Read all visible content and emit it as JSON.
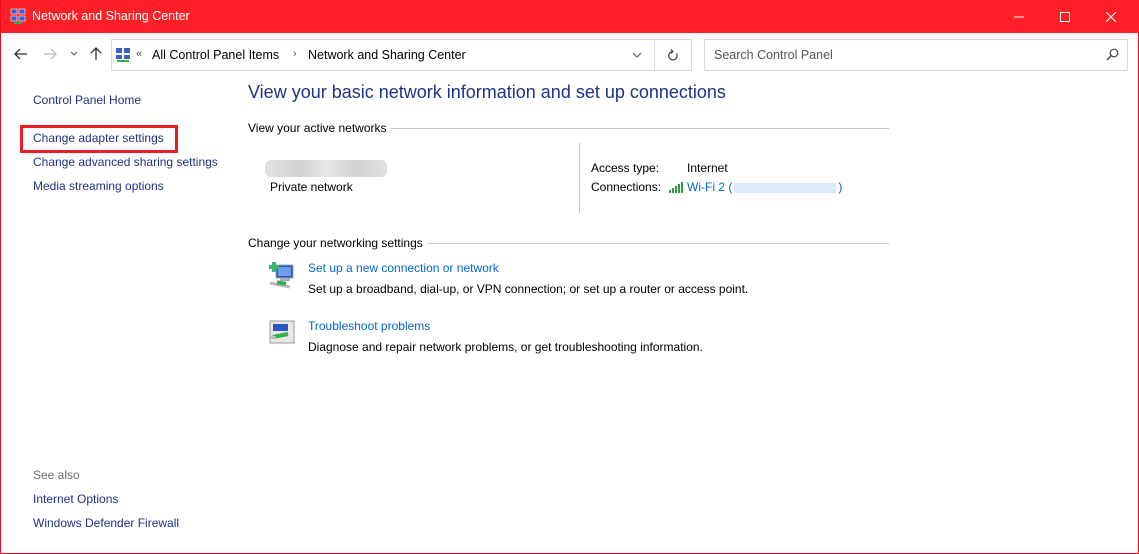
{
  "window": {
    "title": "Network and Sharing Center",
    "controls": {
      "minimize": "—",
      "maximize": "☐",
      "close": "✕"
    },
    "accent_color": "#fe1f27"
  },
  "navigation": {
    "back_icon": "arrow-left-icon",
    "forward_icon": "arrow-right-icon",
    "recent_icon": "chevron-down-icon",
    "up_icon": "arrow-up-icon",
    "breadcrumb": {
      "overflow": "«",
      "items": [
        "All Control Panel Items",
        "Network and Sharing Center"
      ],
      "separator": "›"
    },
    "refresh_icon": "refresh-icon",
    "search": {
      "placeholder": "Search Control Panel",
      "value": ""
    }
  },
  "sidebar": {
    "home": "Control Panel Home",
    "links": [
      "Change adapter settings",
      "Change advanced sharing settings",
      "Media streaming options"
    ],
    "highlighted": "Change adapter settings",
    "see_also_label": "See also",
    "see_also": [
      "Internet Options",
      "Windows Defender Firewall"
    ]
  },
  "main": {
    "heading": "View your basic network information and set up connections",
    "active_networks": {
      "label": "View your active networks",
      "network_category": "Private network",
      "access_type_label": "Access type:",
      "access_type_value": "Internet",
      "connections_label": "Connections:",
      "connection_link_prefix": "Wi-Fi 2 (",
      "connection_link_suffix": ")"
    },
    "change_settings": {
      "label": "Change your networking settings",
      "tasks": [
        {
          "icon": "new-connection-icon",
          "title": "Set up a new connection or network",
          "description": "Set up a broadband, dial-up, or VPN connection; or set up a router or access point."
        },
        {
          "icon": "troubleshoot-icon",
          "title": "Troubleshoot problems",
          "description": "Diagnose and repair network problems, or get troubleshooting information."
        }
      ]
    }
  }
}
